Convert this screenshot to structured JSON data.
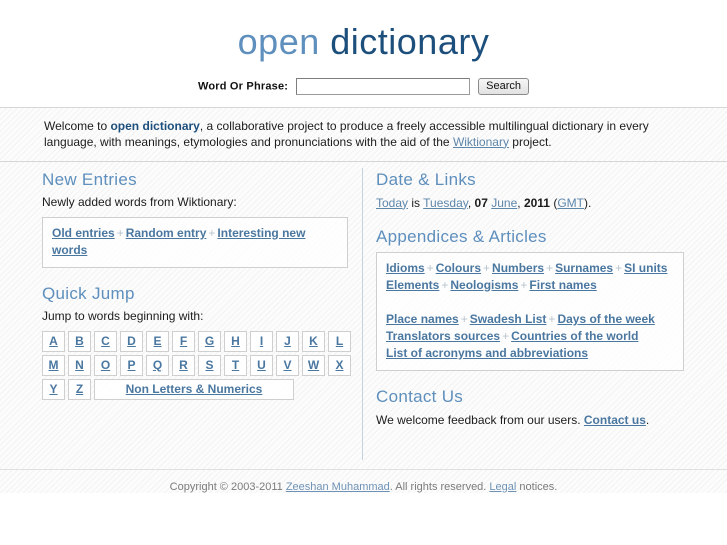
{
  "site": {
    "logo_part1": "open",
    "logo_part2": "dictionary"
  },
  "search": {
    "label": "Word Or Phrase:",
    "value": "",
    "placeholder": "",
    "button": "Search"
  },
  "welcome": {
    "text_before": "Welcome to ",
    "brand1": "open",
    "brand_space": " ",
    "brand2": "dictionary",
    "text_middle": ", a collaborative project to produce a freely accessible multilingual dictionary in every language, with meanings, etymologies and pronunciations with the aid of the ",
    "link": "Wiktionary",
    "text_after": " project."
  },
  "new_entries": {
    "heading": "New Entries",
    "lead": "Newly added words from Wiktionary:",
    "links": [
      "Old entries",
      "Random entry",
      "Interesting new words"
    ],
    "separator": "+"
  },
  "quick_jump": {
    "heading": "Quick Jump",
    "lead": "Jump to words beginning with:",
    "row1": [
      "A",
      "B",
      "C",
      "D",
      "E",
      "F",
      "G",
      "H",
      "I",
      "J",
      "K",
      "L"
    ],
    "row2": [
      "M",
      "N",
      "O",
      "P",
      "Q",
      "R",
      "S",
      "T",
      "U",
      "V",
      "W",
      "X"
    ],
    "row3": [
      "Y",
      "Z"
    ],
    "non_letters": "Non Letters & Numerics"
  },
  "date_links": {
    "heading": "Date & Links",
    "today": "Today",
    "is": " is ",
    "weekday": "Tuesday",
    "comma": ", ",
    "day": "07",
    "space": " ",
    "month": "June",
    "year_sep": ", ",
    "year": "2011",
    "tz_open": " (",
    "tz": "GMT",
    "tz_close": ")."
  },
  "appendices": {
    "heading": "Appendices & Articles",
    "separator": "+",
    "group1": [
      "Idioms",
      "Colours",
      "Numbers",
      "Surnames",
      "SI units"
    ],
    "group1b": [
      "Elements",
      "Neologisms",
      "First names"
    ],
    "group2": [
      "Place names",
      "Swadesh List",
      "Days of the week"
    ],
    "group2b": [
      "Translators sources",
      "Countries of the world"
    ],
    "group2c": [
      "List of acronyms and abbreviations"
    ]
  },
  "contact": {
    "heading": "Contact Us",
    "text": "We welcome feedback from our users. ",
    "link": "Contact us",
    "period": "."
  },
  "footer": {
    "copyright": "Copyright © 2003-2011 ",
    "author": "Zeeshan Muhammad",
    "rights": ". All rights reserved. ",
    "legal": "Legal",
    "notices": " notices."
  },
  "colors": {
    "logo_light": "#5e8fbd",
    "logo_dark": "#1d4f7c",
    "heading": "#5e8fbd",
    "link": "#4a77a0",
    "separator": "#b9c4ce"
  }
}
